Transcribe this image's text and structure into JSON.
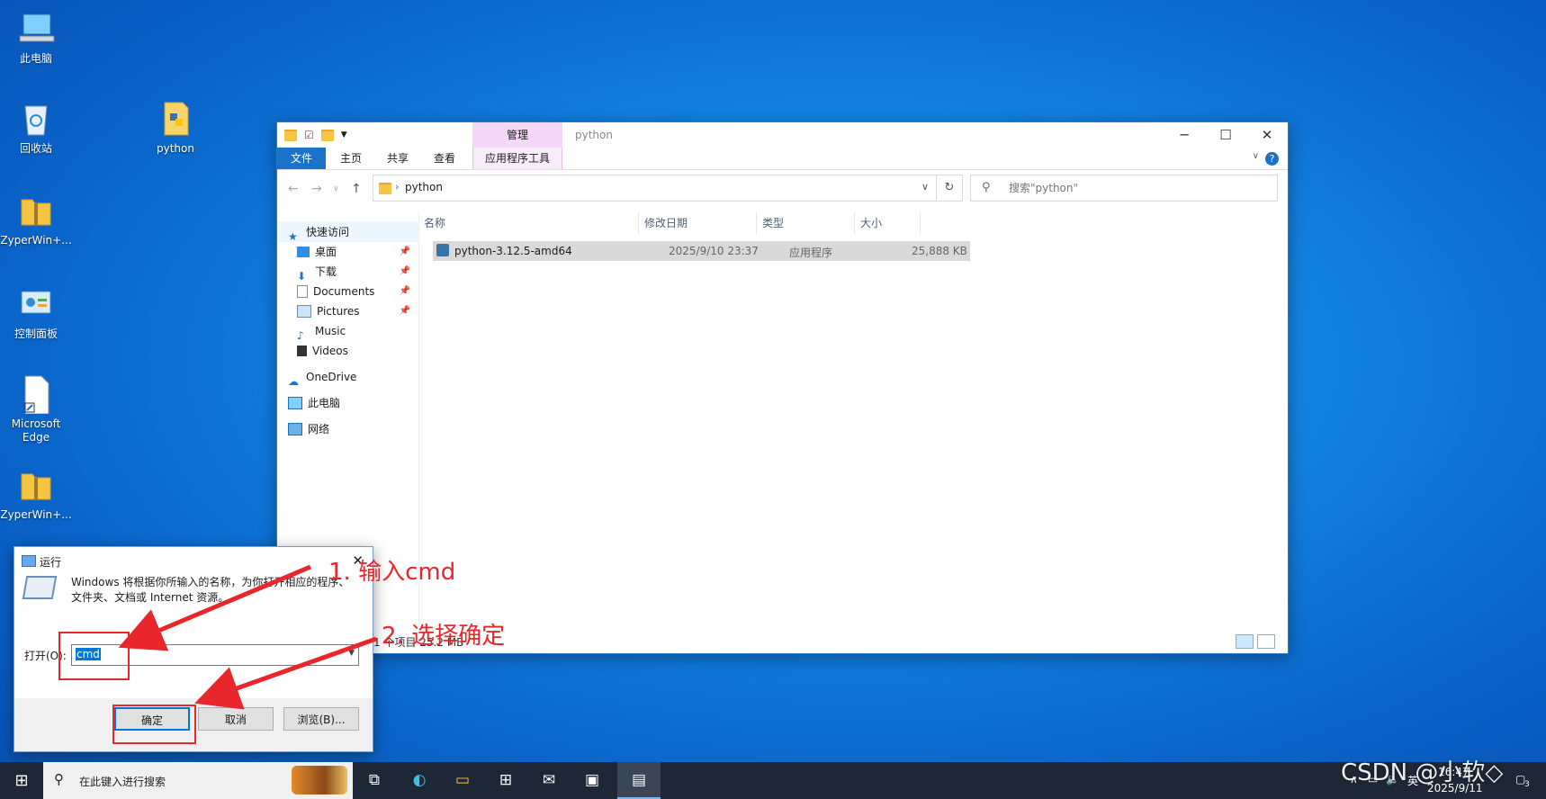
{
  "desktop": {
    "icons": [
      {
        "label": "此电脑"
      },
      {
        "label": "回收站"
      },
      {
        "label": "ZyperWin+..."
      },
      {
        "label": "控制面板"
      },
      {
        "label": "Microsoft Edge"
      },
      {
        "label": "ZyperWin+..."
      },
      {
        "label": "python"
      }
    ]
  },
  "explorer": {
    "ctx_tab": "管理",
    "title": "python",
    "ribbon_tabs": [
      "文件",
      "主页",
      "共享",
      "查看",
      "应用程序工具"
    ],
    "breadcrumb": "python",
    "search_placeholder": "搜索\"python\"",
    "nav": {
      "quick_access": "快速访问",
      "items": [
        "桌面",
        "下载",
        "Documents",
        "Pictures",
        "Music",
        "Videos"
      ],
      "onedrive": "OneDrive",
      "this_pc": "此电脑",
      "network": "网络"
    },
    "columns": {
      "name": "名称",
      "modified": "修改日期",
      "type": "类型",
      "size": "大小"
    },
    "files": [
      {
        "name": "python-3.12.5-amd64",
        "modified": "2025/9/10 23:37",
        "type": "应用程序",
        "size": "25,888 KB"
      }
    ],
    "status": "1 个项目  25.2 MB"
  },
  "run_dialog": {
    "title": "运行",
    "description": "Windows 将根据你所输入的名称，为你打开相应的程序、文件夹、文档或 Internet 资源。",
    "open_label": "打开(O):",
    "input_value": "cmd",
    "ok": "确定",
    "cancel": "取消",
    "browse": "浏览(B)..."
  },
  "annotations": {
    "step1": "1. 输入cmd",
    "step2": "2. 选择确定",
    "color": "#e8262b"
  },
  "taskbar": {
    "search_placeholder": "在此键入进行搜索",
    "tray_lang": "英",
    "time": "16:47",
    "date": "2025/9/11",
    "notification_count": "3"
  },
  "watermark": "CSDN @小软◇"
}
